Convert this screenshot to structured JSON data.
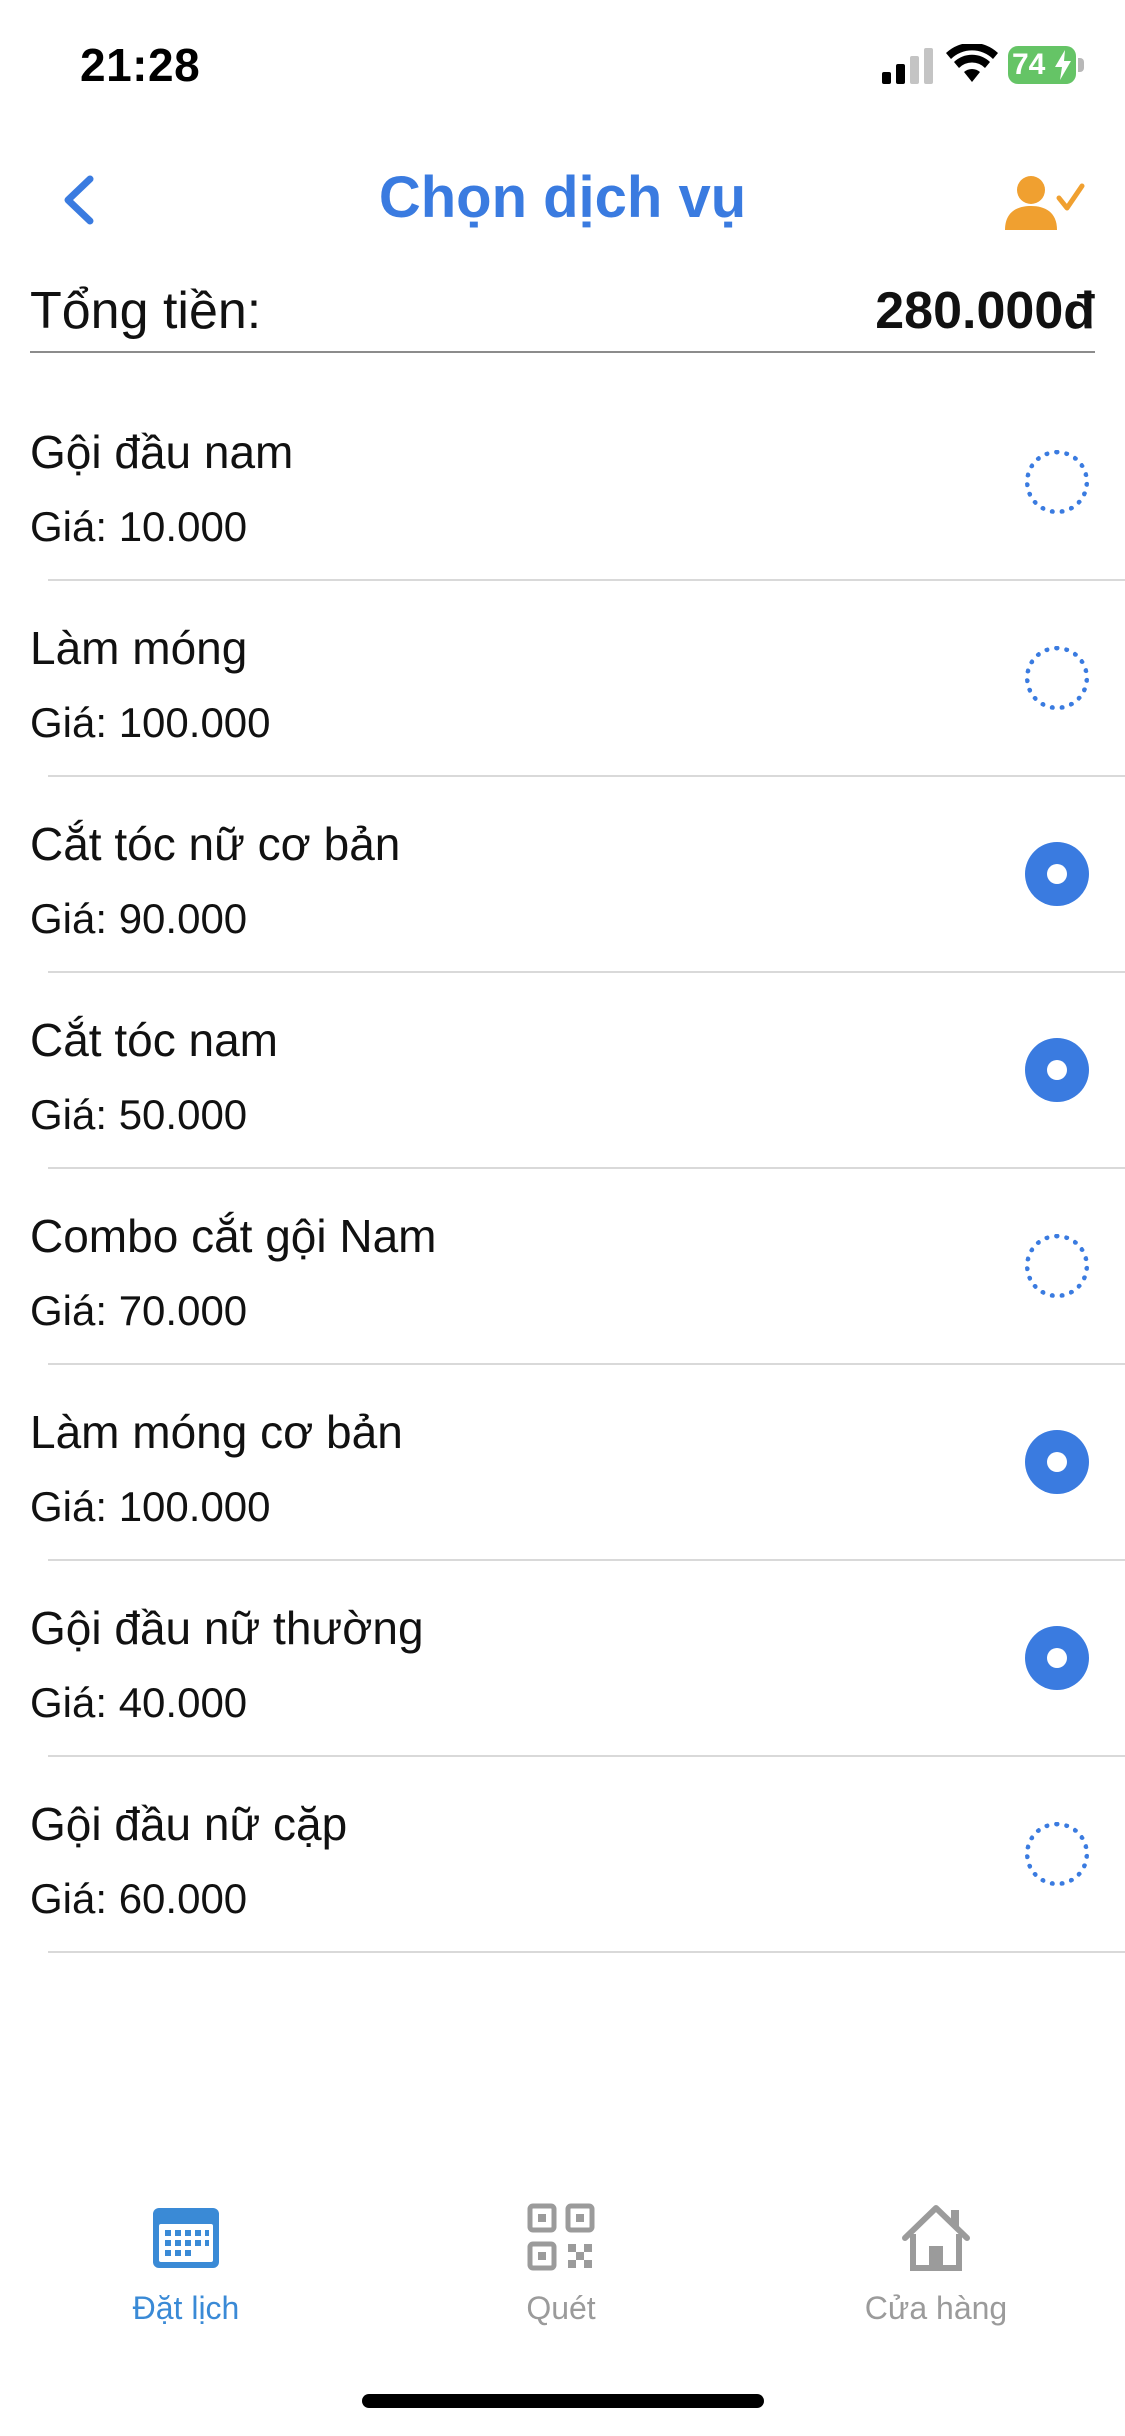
{
  "status_bar": {
    "time": "21:28",
    "battery": "74",
    "signal_icon": "cellular-signal-icon",
    "wifi_icon": "wifi-icon",
    "battery_icon": "battery-charging-icon"
  },
  "header": {
    "title": "Chọn dịch vụ",
    "back_icon": "chevron-left-icon",
    "profile_icon": "user-check-icon"
  },
  "total": {
    "label": "Tổng tiền:",
    "value": "280.000đ"
  },
  "services": [
    {
      "name": "Gội đầu nam",
      "price": "Giá: 10.000",
      "selected": false
    },
    {
      "name": "Làm móng",
      "price": "Giá: 100.000",
      "selected": false
    },
    {
      "name": "Cắt tóc nữ cơ bản",
      "price": "Giá: 90.000",
      "selected": true
    },
    {
      "name": "Cắt tóc nam",
      "price": "Giá: 50.000",
      "selected": true
    },
    {
      "name": "Combo cắt gội Nam",
      "price": "Giá: 70.000",
      "selected": false
    },
    {
      "name": "Làm móng cơ bản",
      "price": "Giá: 100.000",
      "selected": true
    },
    {
      "name": "Gội đầu nữ thường",
      "price": "Giá: 40.000",
      "selected": true
    },
    {
      "name": "Gội đầu nữ cặp",
      "price": "Giá: 60.000",
      "selected": false
    }
  ],
  "tabs": [
    {
      "label": "Đặt lịch",
      "icon": "calendar-icon",
      "active": true
    },
    {
      "label": "Quét",
      "icon": "qr-code-icon",
      "active": false
    },
    {
      "label": "Cửa hàng",
      "icon": "home-icon",
      "active": false
    }
  ],
  "colors": {
    "accent": "#3a7be0",
    "tab_active": "#3a8ad6",
    "tab_inactive": "#9b9b9b",
    "profile_icon": "#f0a030",
    "battery": "#65c466"
  }
}
